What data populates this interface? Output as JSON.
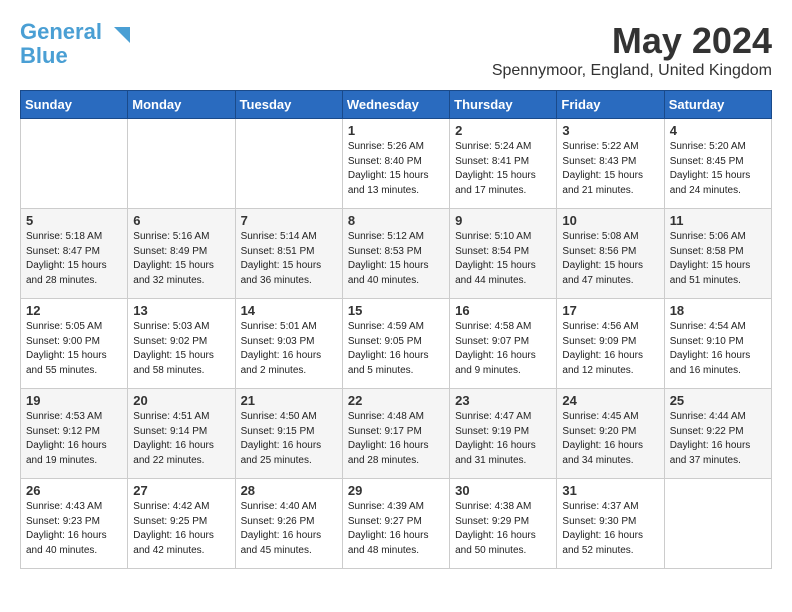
{
  "logo": {
    "line1": "General",
    "line2": "Blue"
  },
  "title": {
    "month_year": "May 2024",
    "location": "Spennymoor, England, United Kingdom"
  },
  "headers": [
    "Sunday",
    "Monday",
    "Tuesday",
    "Wednesday",
    "Thursday",
    "Friday",
    "Saturday"
  ],
  "weeks": [
    [
      {
        "day": "",
        "info": ""
      },
      {
        "day": "",
        "info": ""
      },
      {
        "day": "",
        "info": ""
      },
      {
        "day": "1",
        "info": "Sunrise: 5:26 AM\nSunset: 8:40 PM\nDaylight: 15 hours\nand 13 minutes."
      },
      {
        "day": "2",
        "info": "Sunrise: 5:24 AM\nSunset: 8:41 PM\nDaylight: 15 hours\nand 17 minutes."
      },
      {
        "day": "3",
        "info": "Sunrise: 5:22 AM\nSunset: 8:43 PM\nDaylight: 15 hours\nand 21 minutes."
      },
      {
        "day": "4",
        "info": "Sunrise: 5:20 AM\nSunset: 8:45 PM\nDaylight: 15 hours\nand 24 minutes."
      }
    ],
    [
      {
        "day": "5",
        "info": "Sunrise: 5:18 AM\nSunset: 8:47 PM\nDaylight: 15 hours\nand 28 minutes."
      },
      {
        "day": "6",
        "info": "Sunrise: 5:16 AM\nSunset: 8:49 PM\nDaylight: 15 hours\nand 32 minutes."
      },
      {
        "day": "7",
        "info": "Sunrise: 5:14 AM\nSunset: 8:51 PM\nDaylight: 15 hours\nand 36 minutes."
      },
      {
        "day": "8",
        "info": "Sunrise: 5:12 AM\nSunset: 8:53 PM\nDaylight: 15 hours\nand 40 minutes."
      },
      {
        "day": "9",
        "info": "Sunrise: 5:10 AM\nSunset: 8:54 PM\nDaylight: 15 hours\nand 44 minutes."
      },
      {
        "day": "10",
        "info": "Sunrise: 5:08 AM\nSunset: 8:56 PM\nDaylight: 15 hours\nand 47 minutes."
      },
      {
        "day": "11",
        "info": "Sunrise: 5:06 AM\nSunset: 8:58 PM\nDaylight: 15 hours\nand 51 minutes."
      }
    ],
    [
      {
        "day": "12",
        "info": "Sunrise: 5:05 AM\nSunset: 9:00 PM\nDaylight: 15 hours\nand 55 minutes."
      },
      {
        "day": "13",
        "info": "Sunrise: 5:03 AM\nSunset: 9:02 PM\nDaylight: 15 hours\nand 58 minutes."
      },
      {
        "day": "14",
        "info": "Sunrise: 5:01 AM\nSunset: 9:03 PM\nDaylight: 16 hours\nand 2 minutes."
      },
      {
        "day": "15",
        "info": "Sunrise: 4:59 AM\nSunset: 9:05 PM\nDaylight: 16 hours\nand 5 minutes."
      },
      {
        "day": "16",
        "info": "Sunrise: 4:58 AM\nSunset: 9:07 PM\nDaylight: 16 hours\nand 9 minutes."
      },
      {
        "day": "17",
        "info": "Sunrise: 4:56 AM\nSunset: 9:09 PM\nDaylight: 16 hours\nand 12 minutes."
      },
      {
        "day": "18",
        "info": "Sunrise: 4:54 AM\nSunset: 9:10 PM\nDaylight: 16 hours\nand 16 minutes."
      }
    ],
    [
      {
        "day": "19",
        "info": "Sunrise: 4:53 AM\nSunset: 9:12 PM\nDaylight: 16 hours\nand 19 minutes."
      },
      {
        "day": "20",
        "info": "Sunrise: 4:51 AM\nSunset: 9:14 PM\nDaylight: 16 hours\nand 22 minutes."
      },
      {
        "day": "21",
        "info": "Sunrise: 4:50 AM\nSunset: 9:15 PM\nDaylight: 16 hours\nand 25 minutes."
      },
      {
        "day": "22",
        "info": "Sunrise: 4:48 AM\nSunset: 9:17 PM\nDaylight: 16 hours\nand 28 minutes."
      },
      {
        "day": "23",
        "info": "Sunrise: 4:47 AM\nSunset: 9:19 PM\nDaylight: 16 hours\nand 31 minutes."
      },
      {
        "day": "24",
        "info": "Sunrise: 4:45 AM\nSunset: 9:20 PM\nDaylight: 16 hours\nand 34 minutes."
      },
      {
        "day": "25",
        "info": "Sunrise: 4:44 AM\nSunset: 9:22 PM\nDaylight: 16 hours\nand 37 minutes."
      }
    ],
    [
      {
        "day": "26",
        "info": "Sunrise: 4:43 AM\nSunset: 9:23 PM\nDaylight: 16 hours\nand 40 minutes."
      },
      {
        "day": "27",
        "info": "Sunrise: 4:42 AM\nSunset: 9:25 PM\nDaylight: 16 hours\nand 42 minutes."
      },
      {
        "day": "28",
        "info": "Sunrise: 4:40 AM\nSunset: 9:26 PM\nDaylight: 16 hours\nand 45 minutes."
      },
      {
        "day": "29",
        "info": "Sunrise: 4:39 AM\nSunset: 9:27 PM\nDaylight: 16 hours\nand 48 minutes."
      },
      {
        "day": "30",
        "info": "Sunrise: 4:38 AM\nSunset: 9:29 PM\nDaylight: 16 hours\nand 50 minutes."
      },
      {
        "day": "31",
        "info": "Sunrise: 4:37 AM\nSunset: 9:30 PM\nDaylight: 16 hours\nand 52 minutes."
      },
      {
        "day": "",
        "info": ""
      }
    ]
  ]
}
